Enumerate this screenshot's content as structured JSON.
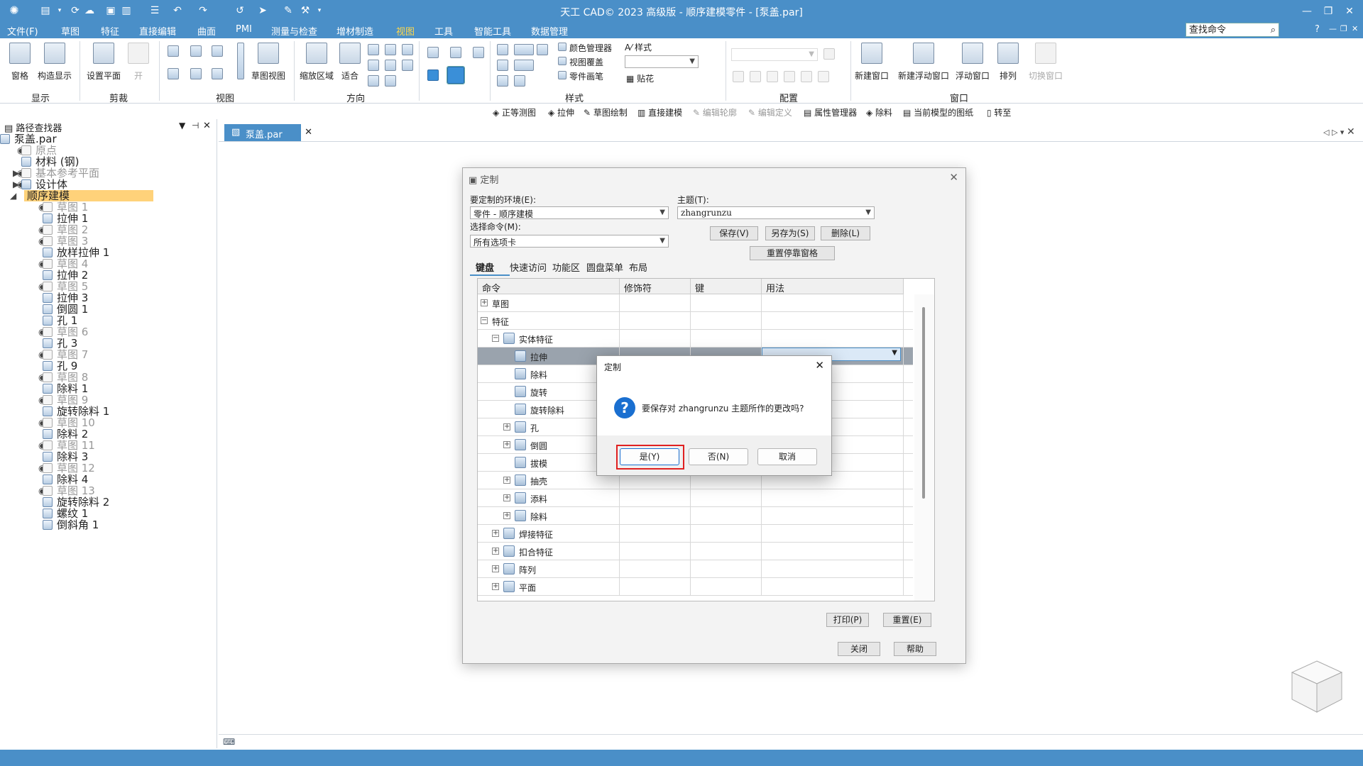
{
  "title": "天工 CAD© 2023 高级版 - 顺序建模零件 - [泵盖.par]",
  "menu": [
    "文件(F)",
    "草图",
    "特征",
    "直接编辑",
    "曲面",
    "PMI",
    "测量与检查",
    "增材制造",
    "视图",
    "工具",
    "智能工具",
    "数据管理"
  ],
  "active_menu": "视图",
  "search_placeholder": "查找命令",
  "ribbon": {
    "buttons": {
      "pane": "窗格",
      "construct_display": "构造显示",
      "set_plane": "设置平面",
      "open": "开",
      "sketch_view": "草图视图",
      "zoom_area": "缩放区域",
      "fit": "适合",
      "color_manager": "颜色管理器",
      "view_override": "视图覆盖",
      "part_painter": "零件画笔",
      "style": "样式",
      "decal": "贴花",
      "new_window": "新建窗口",
      "new_float_window": "新建浮动窗口",
      "float_window": "浮动窗口",
      "arrange": "排列",
      "switch_window": "切换窗口"
    },
    "groups": {
      "display": "显示",
      "clip": "剪裁",
      "view": "视图",
      "orient": "方向",
      "style": "样式",
      "config": "配置",
      "window": "窗口"
    }
  },
  "command_bar": [
    "正等测图",
    "拉伸",
    "草图绘制",
    "直接建模",
    "编辑轮廓",
    "编辑定义",
    "属性管理器",
    "除料",
    "当前模型的图纸",
    "转至"
  ],
  "pathfinder": {
    "title": "路径查找器",
    "items": [
      {
        "text": "泵盖.par",
        "gray": false
      },
      {
        "text": "原点",
        "gray": true
      },
      {
        "text": "材料 (钢)",
        "gray": false
      },
      {
        "text": "基本参考平面",
        "gray": true
      },
      {
        "text": "设计体",
        "gray": false
      },
      {
        "text": "顺序建模",
        "gray": false
      },
      {
        "text": "草图 1",
        "gray": true
      },
      {
        "text": "拉伸 1",
        "gray": false
      },
      {
        "text": "草图 2",
        "gray": true
      },
      {
        "text": "草图 3",
        "gray": true
      },
      {
        "text": "放样拉伸 1",
        "gray": false
      },
      {
        "text": "草图 4",
        "gray": true
      },
      {
        "text": "拉伸 2",
        "gray": false
      },
      {
        "text": "草图 5",
        "gray": true
      },
      {
        "text": "拉伸 3",
        "gray": false
      },
      {
        "text": "倒圆 1",
        "gray": false
      },
      {
        "text": "孔 1",
        "gray": false
      },
      {
        "text": "草图 6",
        "gray": true
      },
      {
        "text": "孔 3",
        "gray": false
      },
      {
        "text": "草图 7",
        "gray": true
      },
      {
        "text": "孔 9",
        "gray": false
      },
      {
        "text": "草图 8",
        "gray": true
      },
      {
        "text": "除料 1",
        "gray": false
      },
      {
        "text": "草图 9",
        "gray": true
      },
      {
        "text": "旋转除料 1",
        "gray": false
      },
      {
        "text": "草图 10",
        "gray": true
      },
      {
        "text": "除料 2",
        "gray": false
      },
      {
        "text": "草图 11",
        "gray": true
      },
      {
        "text": "除料 3",
        "gray": false
      },
      {
        "text": "草图 12",
        "gray": true
      },
      {
        "text": "除料 4",
        "gray": false
      },
      {
        "text": "草图 13",
        "gray": true
      },
      {
        "text": "旋转除料 2",
        "gray": false
      },
      {
        "text": "螺纹 1",
        "gray": false
      },
      {
        "text": "倒斜角 1",
        "gray": false
      }
    ]
  },
  "doc_tab": "泵盖.par",
  "customize_dialog": {
    "title": "定制",
    "env_label": "要定制的环境(E):",
    "env_value": "零件 - 顺序建模",
    "theme_label": "主题(T):",
    "theme_value": "zhangrunzu",
    "select_cmd_label": "选择命令(M):",
    "select_cmd_value": "所有选项卡",
    "save": "保存(V)",
    "save_as": "另存为(S)",
    "delete": "删除(L)",
    "reset_docking": "重置停靠窗格",
    "tabs": [
      "键盘",
      "快速访问",
      "功能区",
      "圆盘菜单",
      "布局"
    ],
    "active_tab": "键盘",
    "columns": [
      "命令",
      "修饰符",
      "键",
      "用法"
    ],
    "rows": [
      {
        "label": "草图",
        "level": 0,
        "pm": "+"
      },
      {
        "label": "特征",
        "level": 0,
        "pm": "−"
      },
      {
        "label": "实体特征",
        "level": 1,
        "pm": "−"
      },
      {
        "label": "拉伸",
        "level": 2,
        "pm": "",
        "selected": true
      },
      {
        "label": "除料",
        "level": 2,
        "pm": ""
      },
      {
        "label": "旋转",
        "level": 2,
        "pm": ""
      },
      {
        "label": "旋转除料",
        "level": 2,
        "pm": ""
      },
      {
        "label": "孔",
        "level": 2,
        "pm": "+"
      },
      {
        "label": "倒圆",
        "level": 2,
        "pm": "+"
      },
      {
        "label": "拔模",
        "level": 2,
        "pm": ""
      },
      {
        "label": "抽壳",
        "level": 2,
        "pm": "+"
      },
      {
        "label": "添料",
        "level": 2,
        "pm": "+"
      },
      {
        "label": "除料",
        "level": 2,
        "pm": "+"
      },
      {
        "label": "焊接特征",
        "level": 1,
        "pm": "+"
      },
      {
        "label": "扣合特征",
        "level": 1,
        "pm": "+"
      },
      {
        "label": "阵列",
        "level": 1,
        "pm": "+"
      },
      {
        "label": "平面",
        "level": 1,
        "pm": "+"
      }
    ],
    "print": "打印(P)",
    "reset": "重置(E)",
    "close": "关闭",
    "help": "帮助"
  },
  "confirm_dialog": {
    "title": "定制",
    "message": "要保存对 zhangrunzu 主题所作的更改吗?",
    "yes": "是(Y)",
    "no": "否(N)",
    "cancel": "取消"
  },
  "colors": {
    "accent": "#4a8fc8",
    "highlight": "#e02020",
    "selected_row": "#9aa3ad",
    "tree_highlight": "#ffd27a"
  }
}
